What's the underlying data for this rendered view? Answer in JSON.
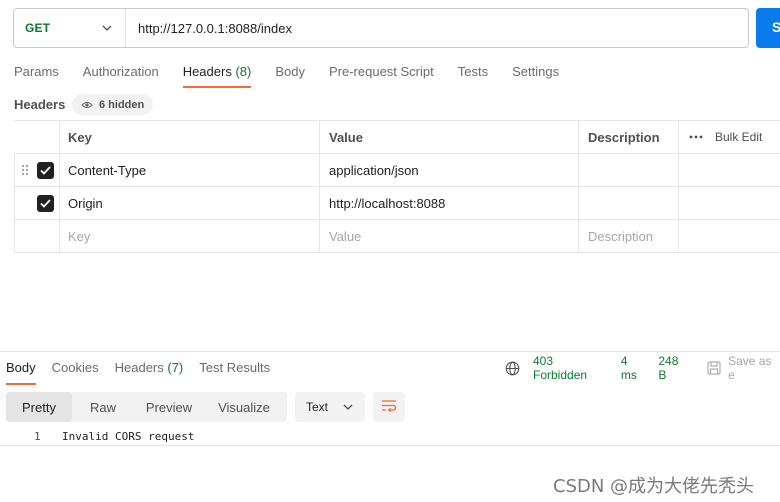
{
  "request": {
    "method": "GET",
    "url": "http://127.0.0.1:8088/index",
    "send_label": "S"
  },
  "request_tabs": [
    {
      "label": "Params"
    },
    {
      "label": "Authorization"
    },
    {
      "label": "Headers",
      "count": "(8)"
    },
    {
      "label": "Body"
    },
    {
      "label": "Pre-request Script"
    },
    {
      "label": "Tests"
    },
    {
      "label": "Settings"
    }
  ],
  "headers_section": {
    "title": "Headers",
    "hidden_label": "6 hidden"
  },
  "table": {
    "columns": {
      "key": "Key",
      "value": "Value",
      "description": "Description",
      "bulk_edit": "Bulk Edit"
    },
    "rows": [
      {
        "key": "Content-Type",
        "value": "application/json",
        "description": "",
        "checked": true
      },
      {
        "key": "Origin",
        "value": "http://localhost:8088",
        "description": "",
        "checked": true
      }
    ],
    "placeholders": {
      "key": "Key",
      "value": "Value",
      "description": "Description"
    }
  },
  "response_tabs": [
    {
      "label": "Body"
    },
    {
      "label": "Cookies"
    },
    {
      "label": "Headers",
      "count": "(7)"
    },
    {
      "label": "Test Results"
    }
  ],
  "status": {
    "code": "403 Forbidden",
    "time": "4 ms",
    "size": "248 B",
    "save_label": "Save as e"
  },
  "view_modes": [
    "Pretty",
    "Raw",
    "Preview",
    "Visualize"
  ],
  "format": "Text",
  "response_body": {
    "line_number": "1",
    "line": "Invalid CORS request"
  },
  "watermark": "CSDN @成为大佬先秃头",
  "colors": {
    "method_green": "#0b7a30",
    "accent_orange": "#f26b3a",
    "send_blue": "#097bed"
  }
}
